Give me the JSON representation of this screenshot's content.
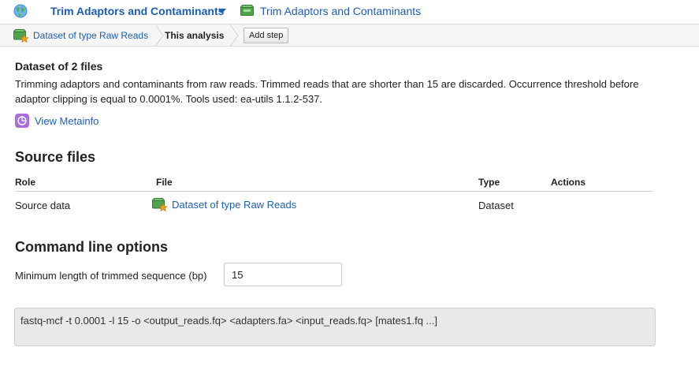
{
  "header": {
    "globe_icon": "globe-icon",
    "title": "Trim Adaptors and Contaminants",
    "folder_icon": "folder-icon",
    "link": "Trim Adaptors and Contaminants"
  },
  "breadcrumb": {
    "dataset_link": "Dataset of type Raw Reads",
    "current": "This analysis",
    "add_step": "Add step"
  },
  "dataset": {
    "heading": "Dataset of 2 files",
    "description": "Trimming adaptors and contaminants from raw reads. Trimmed reads that are shorter than 15 are discarded. Occurrence threshold before adaptor clipping is equal to 0.0001%. Tools used: ea-utils 1.1.2-537.",
    "metainfo_link": "View Metainfo"
  },
  "source_files": {
    "heading": "Source files",
    "columns": [
      "Role",
      "File",
      "Type",
      "Actions"
    ],
    "rows": [
      {
        "role": "Source data",
        "file": "Dataset of type Raw Reads",
        "type": "Dataset",
        "actions": ""
      }
    ]
  },
  "command_line": {
    "heading": "Command line options",
    "min_length_label": "Minimum length of trimmed sequence (bp)",
    "min_length_value": "15",
    "command": "fastq-mcf -t 0.0001 -l 15 -o <output_reads.fq> <adapters.fa> <input_reads.fq> [mates1.fq ...]"
  },
  "colors": {
    "link": "#1f5fa8",
    "breadcrumb_bg": "#f5f5f5",
    "command_bg": "#e9e9e9",
    "folder_green": "#4fa34a",
    "star_orange": "#f0a020",
    "metainfo_purple": "#a96fd6"
  }
}
